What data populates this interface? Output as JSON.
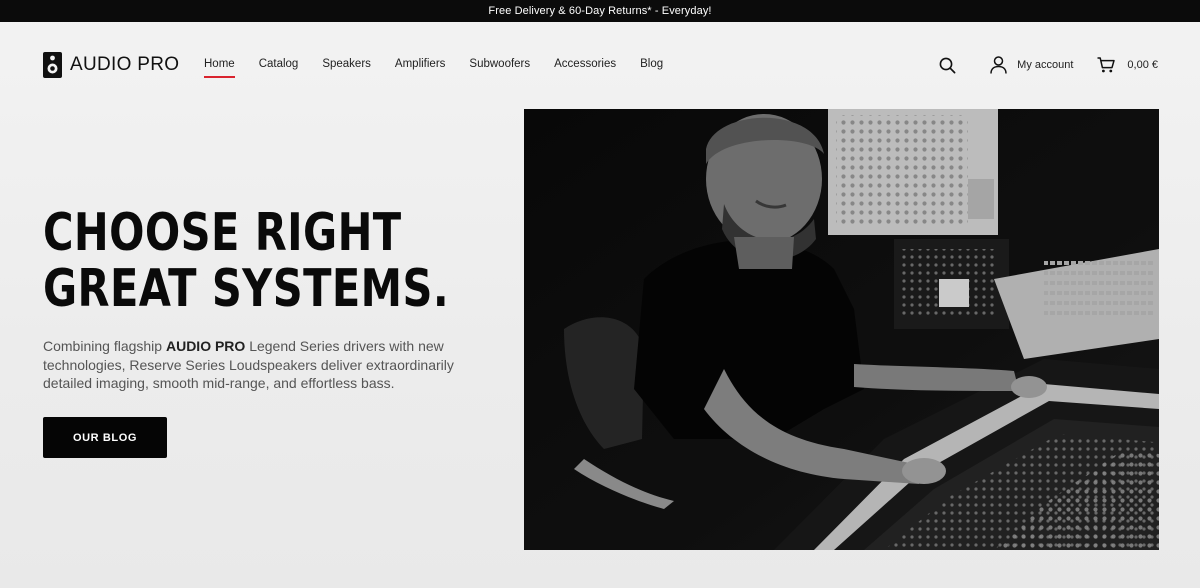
{
  "topbar": {
    "text": "Free Delivery & 60-Day Returns* - Everyday!"
  },
  "header": {
    "logo_text": "AUDIO PRO",
    "nav": [
      {
        "label": "Home",
        "active": true
      },
      {
        "label": "Catalog"
      },
      {
        "label": "Speakers"
      },
      {
        "label": "Amplifiers"
      },
      {
        "label": "Subwoofers"
      },
      {
        "label": "Accessories"
      },
      {
        "label": "Blog"
      }
    ],
    "account_label": "My account",
    "cart_total": "0,00 €",
    "icons": {
      "search": "search-icon",
      "account": "user-icon",
      "cart": "cart-icon"
    }
  },
  "hero": {
    "title_line1": "CHOOSE RIGHT",
    "title_line2": "GREAT SYSTEMS.",
    "desc_before": "Combining flagship ",
    "desc_brand": "AUDIO PRO",
    "desc_after": " Legend Series drivers with new technologies, Reserve Series Loudspeakers deliver extraordinarily detailed imaging, smooth mid-range, and effortless bass.",
    "cta_label": "OUR BLOG"
  },
  "colors": {
    "accent": "#d9232e",
    "topbar_bg": "#0b0b0b",
    "button_bg": "#050505"
  }
}
